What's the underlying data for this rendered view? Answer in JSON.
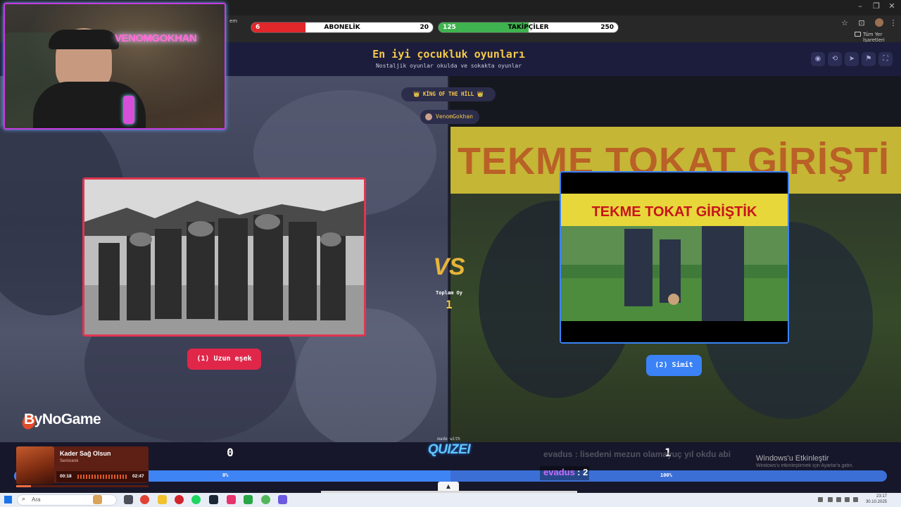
{
  "stream_bars": {
    "subscription": {
      "left": "6",
      "title": "ABONELİK",
      "right": "20",
      "fill": 0.3,
      "color": "#e0272a"
    },
    "followers": {
      "left": "125",
      "title": "TAKİPÇİLER",
      "right": "250",
      "fill": 0.5,
      "color": "#3fb34f"
    }
  },
  "browser": {
    "bookmarks_label": "Tüm Yer İşaretleri",
    "url_fragment": "em"
  },
  "quiz": {
    "title": "En iyi çocukluk oyunları",
    "subtitle": "Nostaljik oyunlar okulda ve sokakta oyunlar",
    "mode_badge": "👑 KİNG OF THE HİLL 👑",
    "user": "VenomGokhan",
    "vs_label": "VS",
    "total_votes_label": "Toplam Oy",
    "total_votes": "1",
    "left_option": "(1) Uzun eşek",
    "right_option": "(2) Simit",
    "right_thumbnail_text": "TEKME TOKAT GİRİŞTİK",
    "right_background_text": "TEKME TOKAT GİRİŞTİ",
    "left_score": "0",
    "right_score": "1",
    "left_percent": "0%",
    "right_percent": "100%",
    "left_percent_value": 0,
    "right_percent_value": 100,
    "made_with": "made with",
    "brand": "QUIZEI"
  },
  "header_buttons": [
    "eye-icon",
    "share-icon",
    "send-icon",
    "flag-icon",
    "fullscreen-icon"
  ],
  "overlay": {
    "webcam_sign": "VENOMGOKHAN",
    "sponsor": "ByNoGame",
    "chat_ghost": "evadus : lisedeni mezun olamayuç yıl okdu abi",
    "chat_user": "evadus",
    "chat_value": ": 2",
    "windows_activate_title": "Windows'u Etkinleştir",
    "windows_activate_sub": "Windows'u etkinleştirmek için Ayarlar'a gidin."
  },
  "music": {
    "title": "Kader Sağ Olsun",
    "artist": "Semicenk",
    "time_current": "00:18",
    "time_total": "02:47",
    "progress": 0.11
  },
  "taskbar": {
    "search_placeholder": "Ara",
    "time": "23:17",
    "date": "30.10.2025"
  },
  "colors": {
    "accent_gold": "#f4c94a",
    "left_red": "#e0274a",
    "right_blue": "#3b82f6",
    "header_bg": "#1c1d3c"
  }
}
